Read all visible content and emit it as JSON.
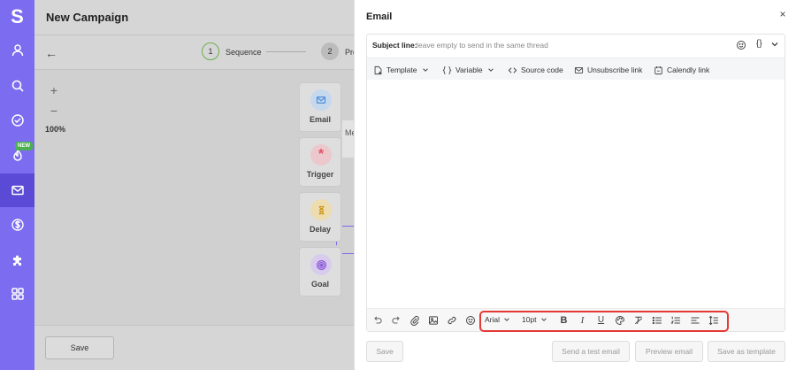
{
  "app": {
    "logo": "S"
  },
  "sidebar": {
    "items": [
      {
        "icon": "user-icon"
      },
      {
        "icon": "search-icon"
      },
      {
        "icon": "check-circle-icon"
      },
      {
        "icon": "flame-icon",
        "badge": "NEW"
      },
      {
        "icon": "mail-icon",
        "active": true
      },
      {
        "icon": "dollar-icon"
      },
      {
        "icon": "puzzle-icon"
      },
      {
        "icon": "grid-icon"
      }
    ],
    "accent": "#7c6cf0"
  },
  "background_page": {
    "title": "New Campaign",
    "steps": [
      {
        "number": "1",
        "label": "Sequence"
      },
      {
        "number": "2",
        "label": "Pro"
      }
    ],
    "zoom": {
      "plus": "+",
      "minus": "−",
      "level": "100%"
    },
    "nodes": [
      {
        "label": "Email",
        "icon": "mail-icon",
        "color": "#4a90d9"
      },
      {
        "label": "Trigger",
        "icon": "asterisk-icon",
        "color": "#e0556b"
      },
      {
        "label": "Delay",
        "icon": "hourglass-icon",
        "color": "#d9a521"
      },
      {
        "label": "Goal",
        "icon": "target-icon",
        "color": "#8a55d9"
      }
    ],
    "truncated_label": "Me",
    "save_label": "Save"
  },
  "email_panel": {
    "title": "Email",
    "close": "×",
    "subject": {
      "label": "Subject line:",
      "placeholder": "leave empty to send in the same thread",
      "braces": "{}"
    },
    "top_toolbar": [
      {
        "label": "Template",
        "icon": "template-icon",
        "dropdown": true
      },
      {
        "label": "Variable",
        "icon": "braces-icon",
        "dropdown": true
      },
      {
        "label": "Source code",
        "icon": "code-icon",
        "dropdown": false
      },
      {
        "label": "Unsubscribe link",
        "icon": "mail-off-icon",
        "dropdown": false
      },
      {
        "label": "Calendly link",
        "icon": "calendar-icon",
        "dropdown": false
      }
    ],
    "format_bar": {
      "font": "Arial",
      "size": "10pt",
      "bold": "B",
      "italic": "I",
      "underline": "U",
      "highlight_color": "#e53935"
    },
    "footer": {
      "save": "Save",
      "test": "Send a test email",
      "preview": "Preview email",
      "template": "Save as template"
    }
  }
}
